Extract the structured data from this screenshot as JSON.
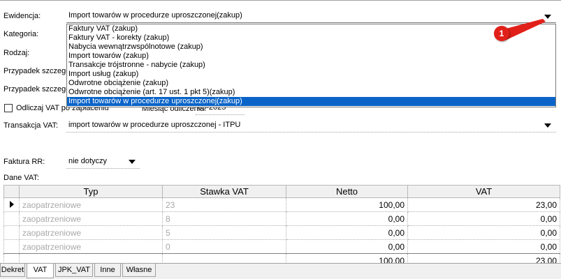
{
  "form": {
    "ewidencja": {
      "label": "Ewidencja:",
      "value": "Import towarów w procedurze uproszczonej(zakup)"
    },
    "kategoria": {
      "label": "Kategoria:"
    },
    "rodzaj": {
      "label": "Rodzaj:"
    },
    "przypadek1": {
      "label": "Przypadek szczegó"
    },
    "przypadek2": {
      "label": "Przypadek szczegó"
    },
    "odliczaj": {
      "label": "Odliczaj VAT po zapłaceniu",
      "checked": false
    },
    "miesiac": {
      "label": "Miesiąc odliczenia:",
      "value": "05-2025"
    },
    "transakcja": {
      "label": "Transakcja VAT:",
      "value": "import towarów w procedurze uproszczonej - ITPU"
    },
    "faktura_rr": {
      "label": "Faktura RR:",
      "value": "nie dotyczy"
    },
    "dane_vat": {
      "label": "Dane VAT:"
    }
  },
  "dropdown": {
    "items": [
      "Faktury VAT (zakup)",
      "Faktury VAT - korekty (zakup)",
      "Nabycia wewnątrzwspólnotowe (zakup)",
      "Import towarów (zakup)",
      "Transakcje trójstronne - nabycie (zakup)",
      "Import usług (zakup)",
      "Odwrotne obciążenie (zakup)",
      "Odwrotne obciążenie (art. 17 ust. 1 pkt 5)(zakup)",
      "Import towarów w procedurze uproszczonej(zakup)"
    ],
    "selected_index": 8
  },
  "callout": {
    "number": "1",
    "color": "#e2201a"
  },
  "grid": {
    "headers": [
      "Typ",
      "Stawka VAT",
      "Netto",
      "VAT"
    ],
    "rows": [
      {
        "typ": "zaopatrzeniowe",
        "stawka": "23",
        "netto": "100,00",
        "vat": "23,00",
        "current": true
      },
      {
        "typ": "zaopatrzeniowe",
        "stawka": "8",
        "netto": "0,00",
        "vat": "0,00",
        "current": false
      },
      {
        "typ": "zaopatrzeniowe",
        "stawka": "5",
        "netto": "0,00",
        "vat": "0,00",
        "current": false
      },
      {
        "typ": "zaopatrzeniowe",
        "stawka": "0",
        "netto": "0,00",
        "vat": "0,00",
        "current": false
      }
    ],
    "summary": {
      "netto": "100,00",
      "vat": "23,00"
    }
  },
  "tabs": [
    {
      "label": "Dekret",
      "active": false
    },
    {
      "label": "VAT",
      "active": true
    },
    {
      "label": "JPK_VAT",
      "active": false
    },
    {
      "label": "Inne",
      "active": false
    },
    {
      "label": "Własne",
      "active": false
    }
  ],
  "colors": {
    "selection": "#0a64c8",
    "callout": "#e2201a"
  }
}
